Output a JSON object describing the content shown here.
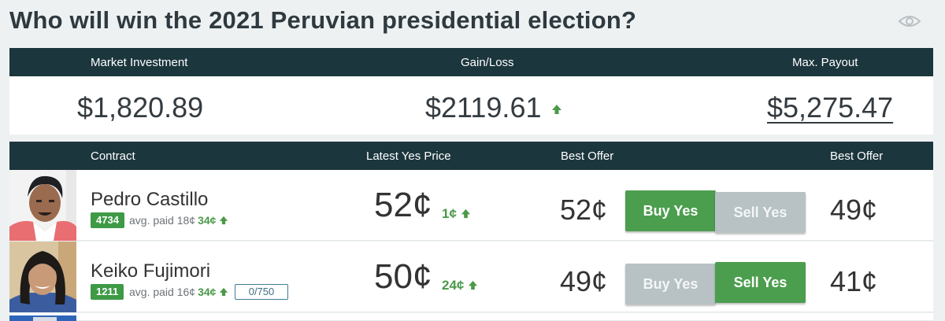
{
  "page": {
    "title": "Who will win the 2021 Peruvian presidential election?",
    "watch_icon": "eye-icon"
  },
  "summary": {
    "headers": [
      "Market Investment",
      "Gain/Loss",
      "Max. Payout"
    ],
    "investment": "$1,820.89",
    "gain_loss": "$2119.61",
    "gain_direction": "up",
    "max_payout": "$5,275.47"
  },
  "contracts_header": {
    "contract": "Contract",
    "latest_yes_price": "Latest Yes Price",
    "best_offer_yes": "Best Offer",
    "best_offer_no": "Best Offer"
  },
  "contracts": [
    {
      "name": "Pedro Castillo",
      "shares": "4734",
      "avg_paid": "avg. paid 18¢",
      "avg_change": "34¢",
      "latest_price": "52¢",
      "price_change": "1¢",
      "best_offer_yes": "52¢",
      "buy_label": "Buy Yes",
      "sell_label": "Sell Yes",
      "best_offer_no": "49¢",
      "active_button": "buy"
    },
    {
      "name": "Keiko Fujimori",
      "shares": "1211",
      "avg_paid": "avg. paid 16¢",
      "avg_change": "34¢",
      "limit": "0/750",
      "latest_price": "50¢",
      "price_change": "24¢",
      "best_offer_yes": "49¢",
      "buy_label": "Buy Yes",
      "sell_label": "Sell Yes",
      "best_offer_no": "41¢",
      "active_button": "sell"
    }
  ],
  "colors": {
    "header_bar": "#1c363d",
    "positive": "#4a9a48",
    "button_active": "#4c9e4f",
    "button_inactive": "#b8c2c5"
  }
}
